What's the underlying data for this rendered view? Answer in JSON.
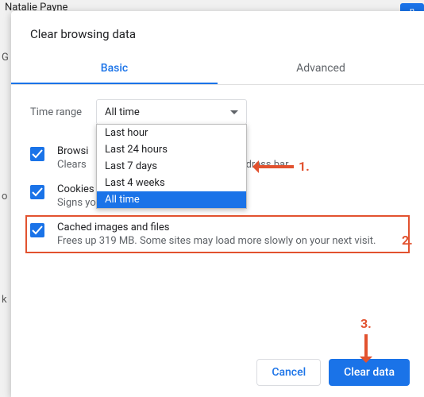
{
  "background": {
    "name": "Natalie Payne",
    "btn_fragment": "n",
    "side": {
      "g": "G",
      "o": "o",
      "k": "k"
    }
  },
  "dialog": {
    "title": "Clear browsing data",
    "tabs": {
      "basic": "Basic",
      "advanced": "Advanced"
    },
    "time_range_label": "Time range",
    "dropdown_selected": "All time",
    "dropdown_options": {
      "o0": "Last hour",
      "o1": "Last 24 hours",
      "o2": "Last 7 days",
      "o3": "Last 4 weeks",
      "o4": "All time"
    },
    "items": {
      "history": {
        "title_fragment": "Browsi",
        "desc_before": "Clears",
        "desc_after": "address bar."
      },
      "cookies": {
        "title": "Cookies and other site data",
        "desc": "Signs you out of most sites."
      },
      "cache": {
        "title": "Cached images and files",
        "desc": "Frees up 319 MB. Some sites may load more slowly on your next visit."
      }
    },
    "buttons": {
      "cancel": "Cancel",
      "clear": "Clear data"
    }
  },
  "annotations": {
    "n1": "1.",
    "n2": "2.",
    "n3": "3."
  }
}
